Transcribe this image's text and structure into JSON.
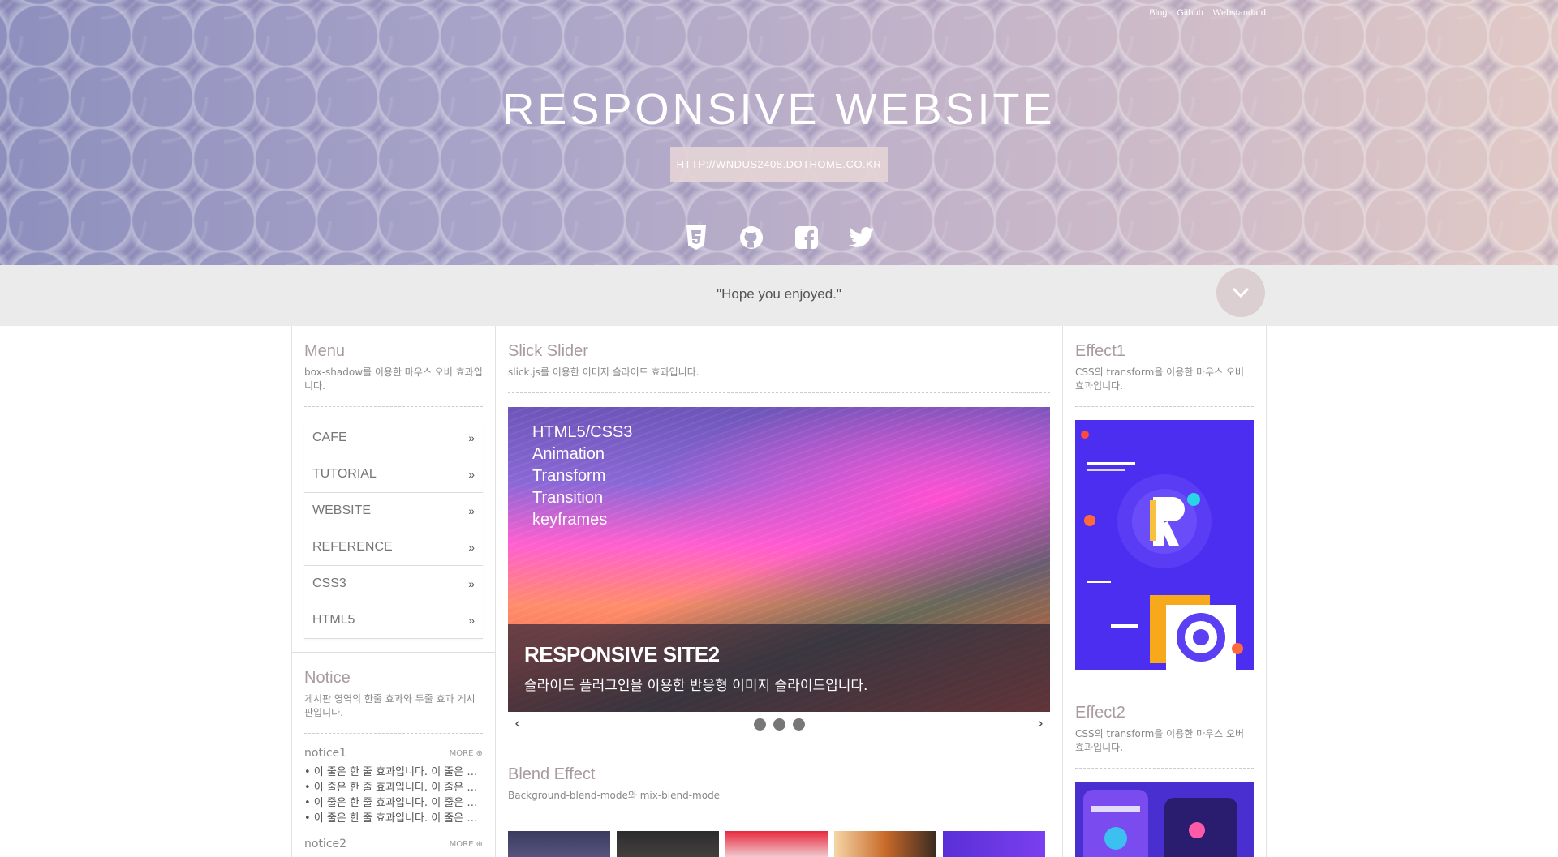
{
  "header": {
    "top_links": [
      "Blog",
      "Github",
      "Webstandard"
    ],
    "title": "RESPONSIVE WEBSITE",
    "url_button": "HTTP://WNDUS2408.DOTHOME.CO.KR",
    "social": [
      "html5-icon",
      "github-icon",
      "facebook-icon",
      "twitter-icon"
    ]
  },
  "quote": "\"Hope you enjoyed.\"",
  "menu": {
    "title": "Menu",
    "desc": "box-shadow를 이용한 마우스 오버 효과입니다.",
    "items": [
      {
        "label": "CAFE"
      },
      {
        "label": "TUTORIAL"
      },
      {
        "label": "WEBSITE"
      },
      {
        "label": "REFERENCE"
      },
      {
        "label": "CSS3"
      },
      {
        "label": "HTML5"
      }
    ],
    "chevron": "»"
  },
  "notice": {
    "title": "Notice",
    "desc": "게시판 영역의 한줄 효과와 두줄 효과 게시판입니다.",
    "groups": [
      {
        "name": "notice1",
        "more": "MORE",
        "lines": [
          "• 이 줄은 한 줄 효과입니다. 이 줄은 한 줄 효과입니다.",
          "• 이 줄은 한 줄 효과입니다. 이 줄은 한 줄 효과입니다.",
          "• 이 줄은 한 줄 효과입니다. 이 줄은 한 줄 효과입니다.",
          "• 이 줄은 한 줄 효과입니다. 이 줄은 한 줄 효과입니다."
        ]
      },
      {
        "name": "notice2",
        "more": "MORE"
      }
    ]
  },
  "slider": {
    "title": "Slick Slider",
    "desc": "slick.js를 이용한 이미지 슬라이드 효과입니다.",
    "tags": [
      "HTML5/CSS3",
      "Animation",
      "Transform",
      "Transition",
      "keyframes"
    ],
    "caption_title": "RESPONSIVE SITE2",
    "caption_desc": "슬라이드 플러그인을 이용한 반응형 이미지 슬라이드입니다.",
    "prev": "‹",
    "next": "›",
    "dots": 3
  },
  "blend": {
    "title": "Blend Effect",
    "desc": "Background-blend-mode와 mix-blend-mode"
  },
  "effect1": {
    "title": "Effect1",
    "desc": "CSS의 transform을 이용한 마우스 오버 효과입니다."
  },
  "effect2": {
    "title": "Effect2",
    "desc": "CSS의 transform을 이용한 마우스 오버 효과입니다."
  },
  "colors": {
    "accent": "#a89a9d",
    "quote_bar": "#ebebeb",
    "down_button": "#dccfd2"
  }
}
